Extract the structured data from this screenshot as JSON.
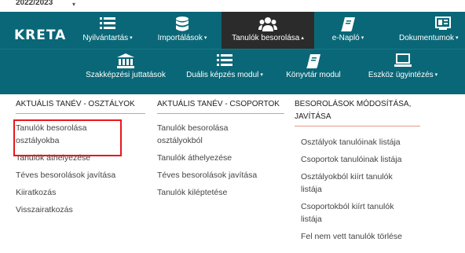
{
  "topbar": {
    "year": "2022/2023",
    "year_caret": "▾"
  },
  "brand": {
    "logo": "KRETA"
  },
  "nav_row1": [
    {
      "icon": "list-icon",
      "label": "Nyilvántartás",
      "caret": "▾"
    },
    {
      "icon": "database-icon",
      "label": "Importálások",
      "caret": "▾"
    },
    {
      "icon": "users-icon",
      "label": "Tanulók besorolása",
      "caret": "▴",
      "active": true
    },
    {
      "icon": "book-icon",
      "label": "e-Napló",
      "caret": "▾"
    },
    {
      "icon": "document-icon",
      "label": "Dokumentumok",
      "caret": "▾"
    }
  ],
  "nav_row2": [
    {
      "icon": "bank-icon",
      "label": "Szakképzési juttatások",
      "caret": ""
    },
    {
      "icon": "list-icon",
      "label": "Duális képzés modul",
      "caret": "▾"
    },
    {
      "icon": "book-icon",
      "label": "Könyvtár modul",
      "caret": ""
    },
    {
      "icon": "laptop-icon",
      "label": "Eszköz ügyintézés",
      "caret": "▾"
    }
  ],
  "menu": {
    "col1": {
      "heading": "AKTUÁLIS TANÉV - OSZTÁLYOK",
      "items": [
        "Tanulók besorolása osztályokba",
        "Tanulók áthelyezése",
        "Téves besorolások javítása",
        "Kiiratkozás",
        "Visszairatkozás"
      ]
    },
    "col2": {
      "heading": "AKTUÁLIS TANÉV - CSOPORTOK",
      "items": [
        "Tanulók besorolása osztályokból",
        "Tanulók áthelyezése",
        "Téves besorolások javítása",
        "Tanulók kiléptetése"
      ]
    },
    "col3": {
      "heading": "BESOROLÁSOK MÓDOSÍTÁSA, JAVÍTÁSA",
      "items": [
        "Osztályok tanulóinak listája",
        "Csoportok tanulóinak listája",
        "Osztályokból kiírt tanulók listája",
        "Csoportokból kiírt tanulók listája",
        "Fel nem vett tanulók törlése"
      ]
    }
  },
  "colors": {
    "navbar": "#0a6777",
    "active": "#2b2b2b",
    "heading_underline": "#e49a86",
    "highlight": "#e8171c"
  }
}
